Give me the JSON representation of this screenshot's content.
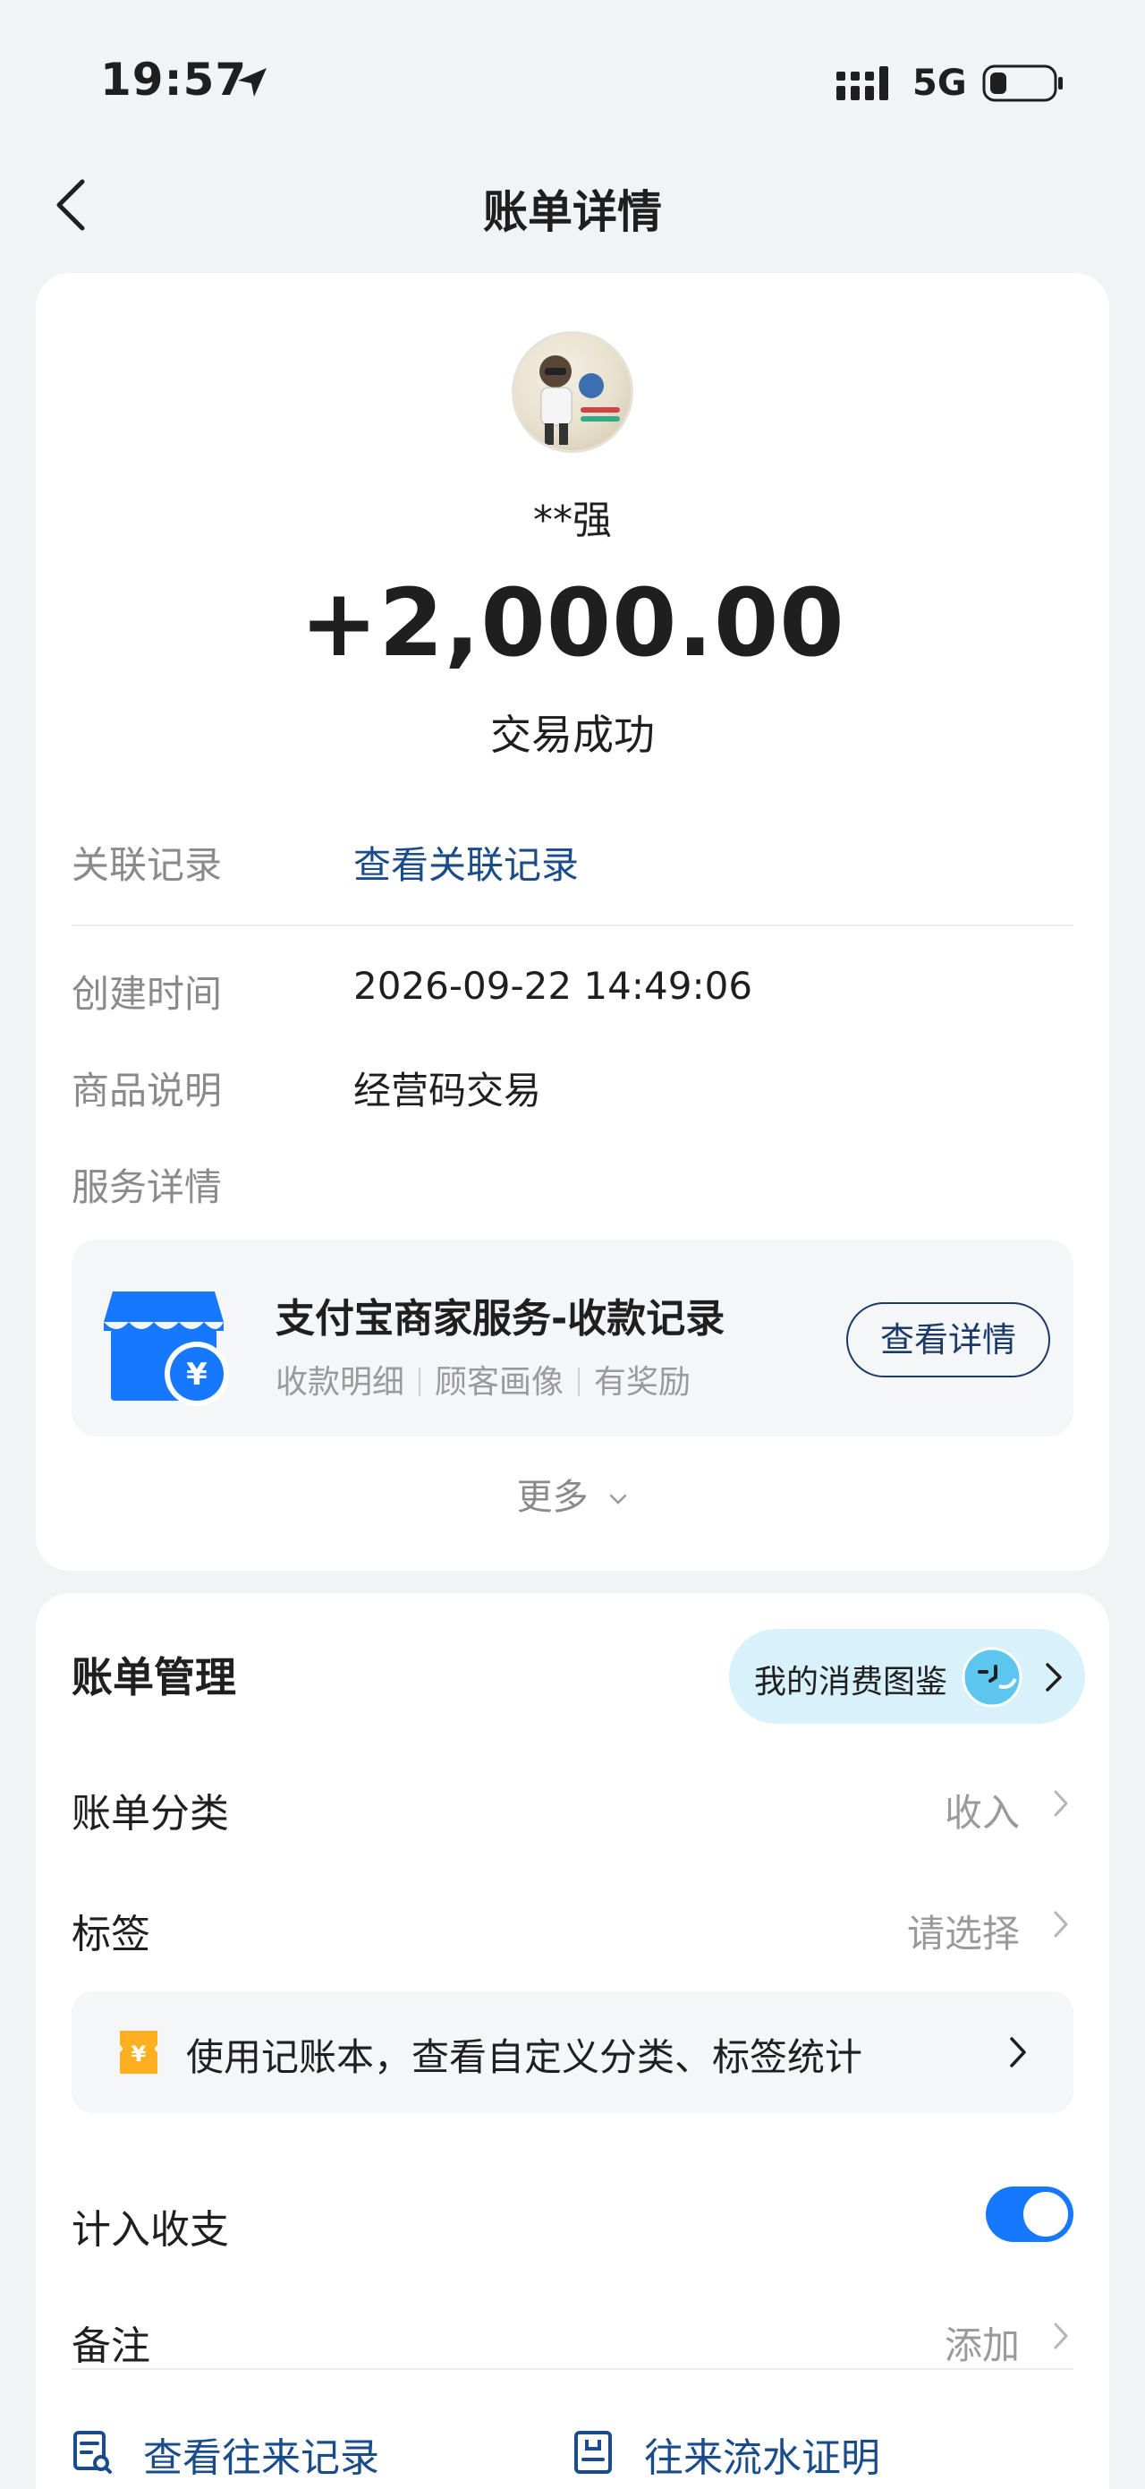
{
  "status_bar": {
    "time": "19:57",
    "network": "5G"
  },
  "nav": {
    "title": "账单详情",
    "back_icon": "chevron-left-icon"
  },
  "transaction": {
    "payer_name": "**强",
    "amount": "+2,000.00",
    "status": "交易成功"
  },
  "details": {
    "related_label": "关联记录",
    "related_link": "查看关联记录",
    "created_label": "创建时间",
    "created_value": "2026-09-22 14:49:06",
    "goods_label": "商品说明",
    "goods_value": "经营码交易",
    "service_label": "服务详情"
  },
  "service_card": {
    "title": "支付宝商家服务-收款记录",
    "tags": [
      "收款明细",
      "顾客画像",
      "有奖励"
    ],
    "button": "查看详情",
    "icon": "store-icon"
  },
  "more_label": "更多",
  "management": {
    "title": "账单管理",
    "pill_label": "我的消费图鉴",
    "category_label": "账单分类",
    "category_value": "收入",
    "tag_label": "标签",
    "tag_value": "请选择",
    "bookkeeping_text": "使用记账本，查看自定义分类、标签统计",
    "include_label": "计入收支",
    "include_enabled": true,
    "note_label": "备注",
    "note_value": "添加"
  },
  "bottom_links": {
    "history": "查看往来记录",
    "statement": "往来流水证明"
  },
  "colors": {
    "accent_blue": "#1677ff",
    "link_blue": "#1a4c8c",
    "pill_bg": "#d9f1fb"
  }
}
